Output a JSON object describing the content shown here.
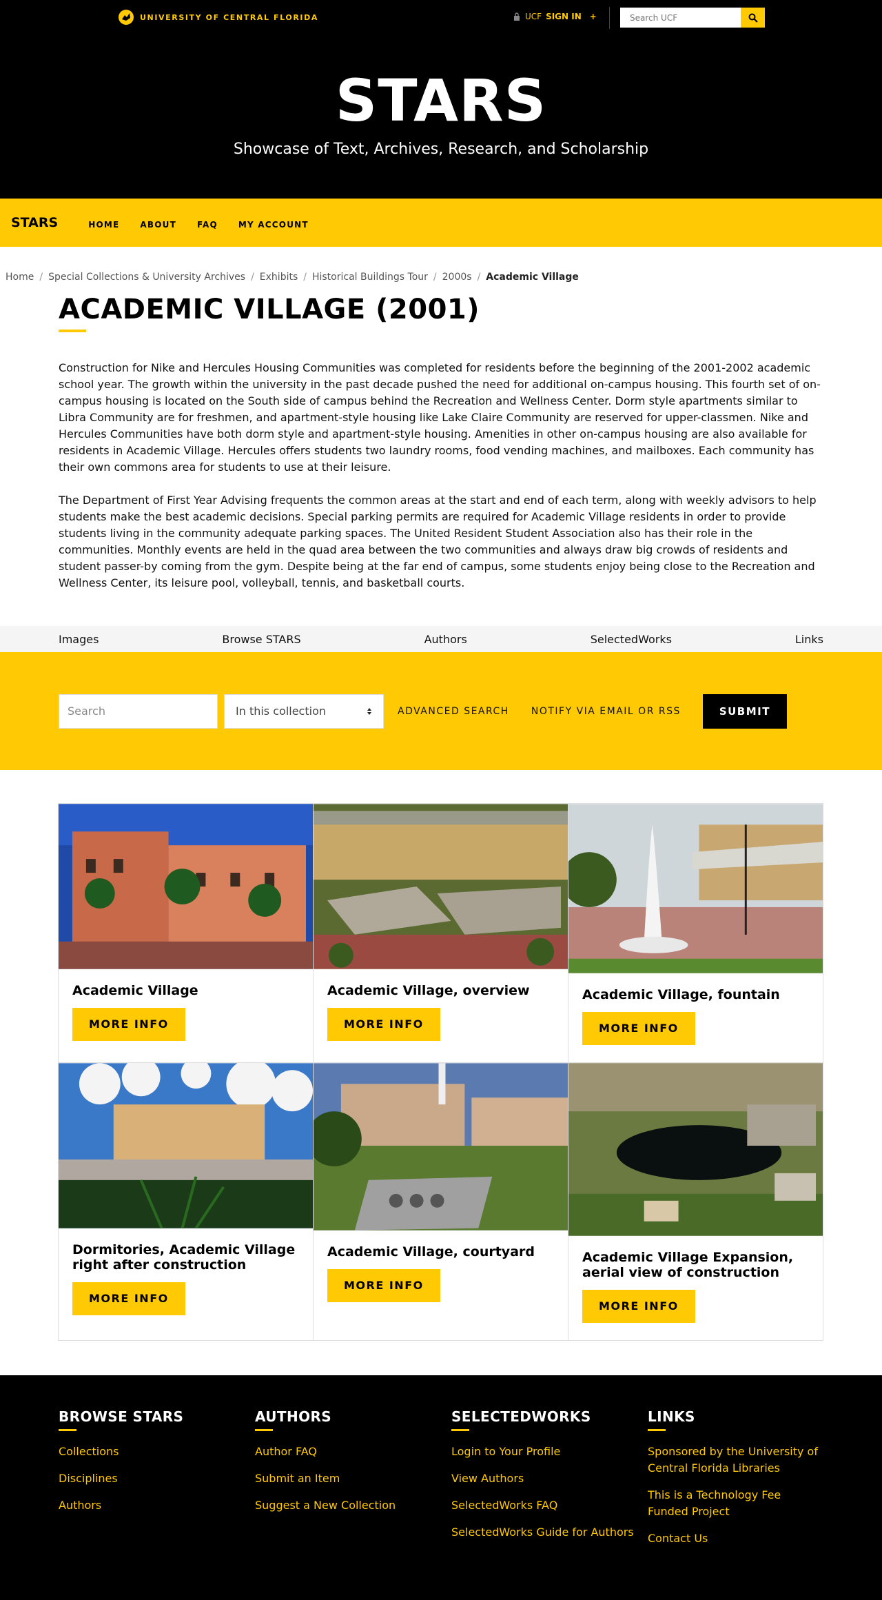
{
  "topbar": {
    "university": "UNIVERSITY OF CENTRAL FLORIDA",
    "signin_prefix": "UCF",
    "signin_label": "SIGN IN",
    "signin_plus": "+",
    "search_placeholder": "Search UCF"
  },
  "hero": {
    "title": "STARS",
    "subtitle": "Showcase of Text, Archives, Research, and Scholarship"
  },
  "nav": {
    "brand": "STARS",
    "items": [
      "HOME",
      "ABOUT",
      "FAQ",
      "MY ACCOUNT"
    ]
  },
  "breadcrumb": {
    "items": [
      "Home",
      "Special Collections & University Archives",
      "Exhibits",
      "Historical Buildings Tour",
      "2000s"
    ],
    "current": "Academic Village"
  },
  "page": {
    "title": "ACADEMIC VILLAGE (2001)",
    "paragraphs": [
      "Construction for Nike and Hercules Housing Communities was completed for residents before the beginning of the 2001-2002 academic school year. The growth within the university in the past decade pushed the need for additional on-campus housing. This fourth set of on-campus housing is located on the South side of campus behind the Recreation and Wellness Center. Dorm style apartments similar to Libra Community are for freshmen, and apartment-style housing like Lake Claire Community are reserved for upper-classmen. Nike and Hercules Communities have both dorm style and apartment-style housing. Amenities in other on-campus housing are also available for residents in Academic Village. Hercules offers students two laundry rooms, food vending machines, and mailboxes. Each community has their own commons area for students to use at their leisure.",
      "The Department of First Year Advising frequents the common areas at the start and end of each term, along with weekly advisors to help students make the best academic decisions. Special parking permits are required for Academic Village residents in order to provide students living in the community adequate parking spaces. The United Resident Student Association also has their role in the communities. Monthly events are held in the quad area between the two communities and always draw big crowds of residents and student passer-by coming from the gym. Despite being at the far end of campus, some students enjoy being close to the Recreation and Wellness Center, its leisure pool, volleyball, tennis, and basketball courts."
    ]
  },
  "subnav": {
    "items": [
      "Images",
      "Browse STARS",
      "Authors",
      "SelectedWorks",
      "Links"
    ]
  },
  "search": {
    "placeholder": "Search",
    "scope": "In this collection",
    "advanced": "ADVANCED SEARCH",
    "notify": "NOTIFY VIA EMAIL OR RSS",
    "submit": "SUBMIT"
  },
  "gallery": {
    "button_label": "MORE INFO",
    "items": [
      {
        "title": "Academic Village"
      },
      {
        "title": "Academic Village, overview"
      },
      {
        "title": "Academic Village, fountain"
      },
      {
        "title": "Dormitories, Academic Village right after construction"
      },
      {
        "title": "Academic Village, courtyard"
      },
      {
        "title": "Academic Village Expansion, aerial view of construction"
      }
    ]
  },
  "footer": {
    "columns": [
      {
        "heading": "BROWSE STARS",
        "links": [
          "Collections",
          "Disciplines",
          "Authors"
        ]
      },
      {
        "heading": "AUTHORS",
        "links": [
          "Author FAQ",
          "Submit an Item",
          "Suggest a New Collection"
        ]
      },
      {
        "heading": "SELECTEDWORKS",
        "links": [
          "Login to Your Profile",
          "View Authors",
          "SelectedWorks FAQ",
          "SelectedWorks Guide for Authors"
        ]
      },
      {
        "heading": "LINKS",
        "links": [
          "Sponsored by the University of Central Florida Libraries",
          "This is a Technology Fee Funded Project",
          "Contact Us"
        ]
      }
    ]
  },
  "colors": {
    "gold": "#ffc904",
    "black": "#000000"
  }
}
